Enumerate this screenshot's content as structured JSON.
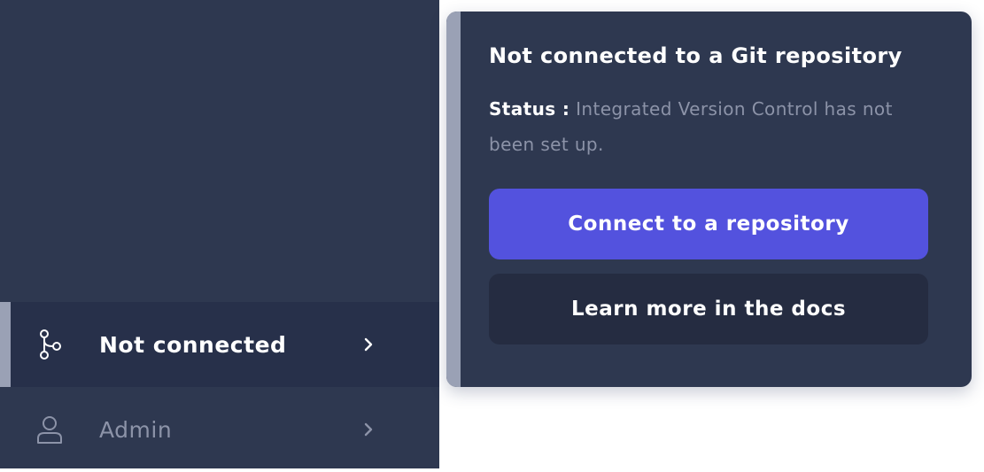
{
  "sidebar": {
    "items": [
      {
        "label": "Not connected",
        "icon": "git-branch-icon",
        "active": true
      },
      {
        "label": "Admin",
        "icon": "user-icon",
        "active": false
      }
    ]
  },
  "popover": {
    "title": "Not connected to a Git repository",
    "status_label": "Status :",
    "status_text": "Integrated Version Control has not been set up.",
    "primary_button": "Connect to a repository",
    "secondary_button": "Learn more in the docs"
  },
  "colors": {
    "sidebar_bg": "#2e3850",
    "active_item_bg": "#27304a",
    "accent_stripe": "#9aa1b5",
    "primary_button": "#5352de",
    "secondary_button": "#252c41",
    "muted_text": "#8c93a8"
  }
}
